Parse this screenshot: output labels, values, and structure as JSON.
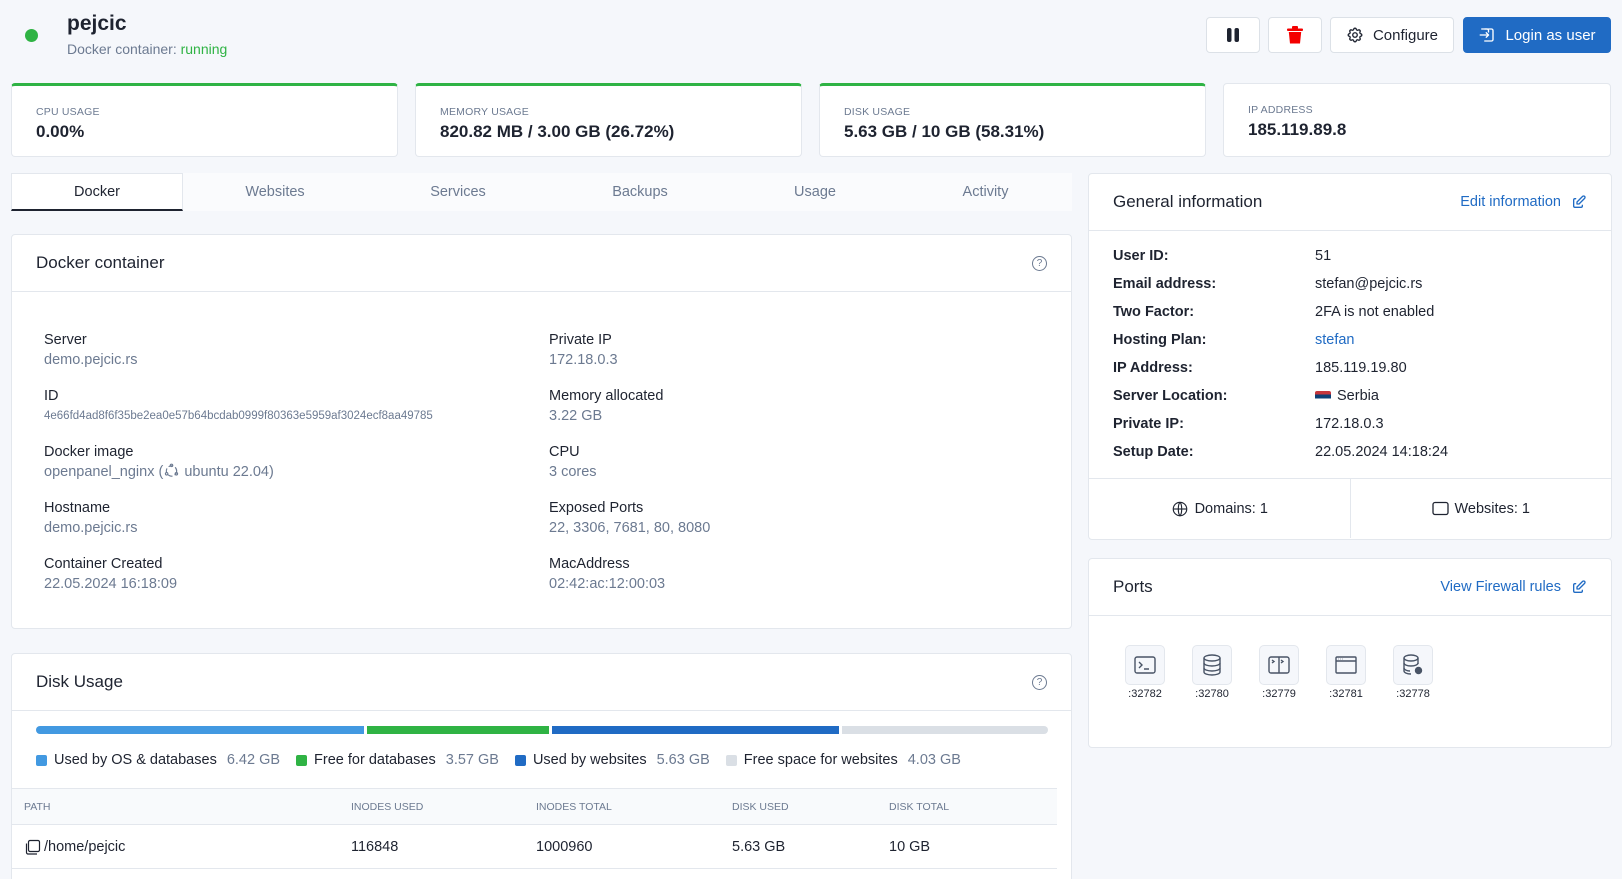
{
  "header": {
    "username": "pejcic",
    "status_prefix": "Docker container:",
    "status": "running",
    "status_color": "#2fb344",
    "buttons": {
      "pause_icon": "pause-icon",
      "delete_icon": "trash-icon",
      "configure": "Configure",
      "login": "Login as user"
    }
  },
  "stats": [
    {
      "label": "CPU USAGE",
      "value": "0.00%"
    },
    {
      "label": "MEMORY USAGE",
      "value": "820.82 MB / 3.00 GB (26.72%)"
    },
    {
      "label": "DISK USAGE",
      "value": "5.63 GB / 10 GB (58.31%)"
    },
    {
      "label": "IP ADDRESS",
      "value": "185.119.89.8"
    }
  ],
  "tabs": [
    {
      "label": "Docker",
      "active": true
    },
    {
      "label": "Websites"
    },
    {
      "label": "Services"
    },
    {
      "label": "Backups"
    },
    {
      "label": "Usage"
    },
    {
      "label": "Activity"
    }
  ],
  "docker_container": {
    "title": "Docker container",
    "left": [
      {
        "key": "Server",
        "value": "demo.pejcic.rs"
      },
      {
        "key": "ID",
        "value": "4e66fd4ad8f6f35be2ea0e57b64bcdab0999f80363e5959af3024ecf8aa49785"
      },
      {
        "key": "Docker image",
        "value_image": "openpanel_nginx (",
        "value_os": "ubuntu 22.04)"
      },
      {
        "key": "Hostname",
        "value": "demo.pejcic.rs"
      },
      {
        "key": "Container Created",
        "value": "22.05.2024 16:18:09"
      }
    ],
    "right": [
      {
        "key": "Private IP",
        "value": "172.18.0.3"
      },
      {
        "key": "Memory allocated",
        "value": "3.22 GB"
      },
      {
        "key": "CPU",
        "value": "3 cores"
      },
      {
        "key": "Exposed Ports",
        "value": "22, 3306, 7681, 80, 8080"
      },
      {
        "key": "MacAddress",
        "value": "02:42:ac:12:00:03"
      }
    ]
  },
  "disk_usage": {
    "title": "Disk Usage",
    "segments": [
      {
        "name": "Used by OS & databases",
        "value": "6.42 GB",
        "gb": 6.42,
        "color": "#4299e1"
      },
      {
        "name": "Free for databases",
        "value": "3.57 GB",
        "gb": 3.57,
        "color": "#2fb344"
      },
      {
        "name": "Used by websites",
        "value": "5.63 GB",
        "gb": 5.63,
        "color": "#206bc4"
      },
      {
        "name": "Free space for websites",
        "value": "4.03 GB",
        "gb": 4.03,
        "color": "#dadfe5"
      }
    ],
    "table": {
      "headers": [
        "PATH",
        "INODES USED",
        "INODES TOTAL",
        "DISK USED",
        "DISK TOTAL"
      ],
      "rows": [
        [
          "/home/pejcic",
          "116848",
          "1000960",
          "5.63 GB",
          "10 GB"
        ]
      ]
    }
  },
  "general_info": {
    "title": "General information",
    "edit_label": "Edit information",
    "rows": [
      {
        "key": "User ID:",
        "value": "51"
      },
      {
        "key": "Email address:",
        "value": "stefan@pejcic.rs"
      },
      {
        "key": "Two Factor:",
        "value": "2FA is not enabled"
      },
      {
        "key": "Hosting Plan:",
        "value": "stefan"
      },
      {
        "key": "IP Address:",
        "value": "185.119.19.80"
      },
      {
        "key": "Server Location:",
        "value": "Serbia"
      },
      {
        "key": "Private IP:",
        "value": "172.18.0.3"
      },
      {
        "key": "Setup Date:",
        "value": "22.05.2024 14:18:24"
      }
    ],
    "domains": "Domains: 1",
    "websites": "Websites: 1"
  },
  "ports": {
    "title": "Ports",
    "link": "View Firewall rules",
    "items": [
      {
        "port": ":32782",
        "icon": "terminal-icon"
      },
      {
        "port": ":32780",
        "icon": "database-icon"
      },
      {
        "port": ":32779",
        "icon": "split-terminal-icon"
      },
      {
        "port": ":32781",
        "icon": "browser-window-icon"
      },
      {
        "port": ":32778",
        "icon": "database-cog-icon"
      }
    ]
  }
}
